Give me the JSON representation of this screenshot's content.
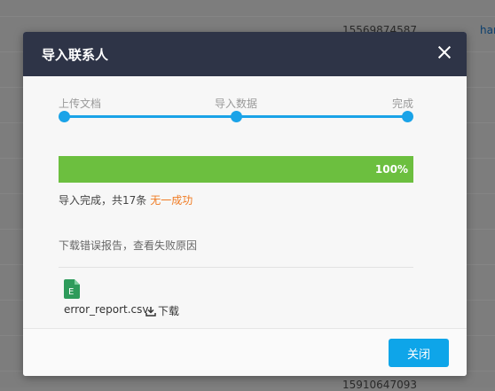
{
  "background": {
    "top_phone": "15569874587",
    "top_link": "han",
    "bottom_phone": "15910647093"
  },
  "modal": {
    "title": "导入联系人",
    "close_icon": "close-icon",
    "steps": [
      {
        "label": "上传文档"
      },
      {
        "label": "导入数据"
      },
      {
        "label": "完成"
      }
    ],
    "progress": {
      "percent": 100,
      "label": "100%"
    },
    "result_text": "导入完成，共17条",
    "result_fail": "无一成功",
    "download_hint": "下载错误报告，查看失败原因",
    "file": {
      "icon": "excel-file-icon",
      "name": "error_report.csv"
    },
    "download_label": "下载",
    "close_button": "关闭"
  },
  "colors": {
    "header": "#2e3447",
    "accent": "#1aa3e8",
    "progress": "#6cbf3f",
    "fail": "#f07b22",
    "button": "#0ea5e9"
  }
}
